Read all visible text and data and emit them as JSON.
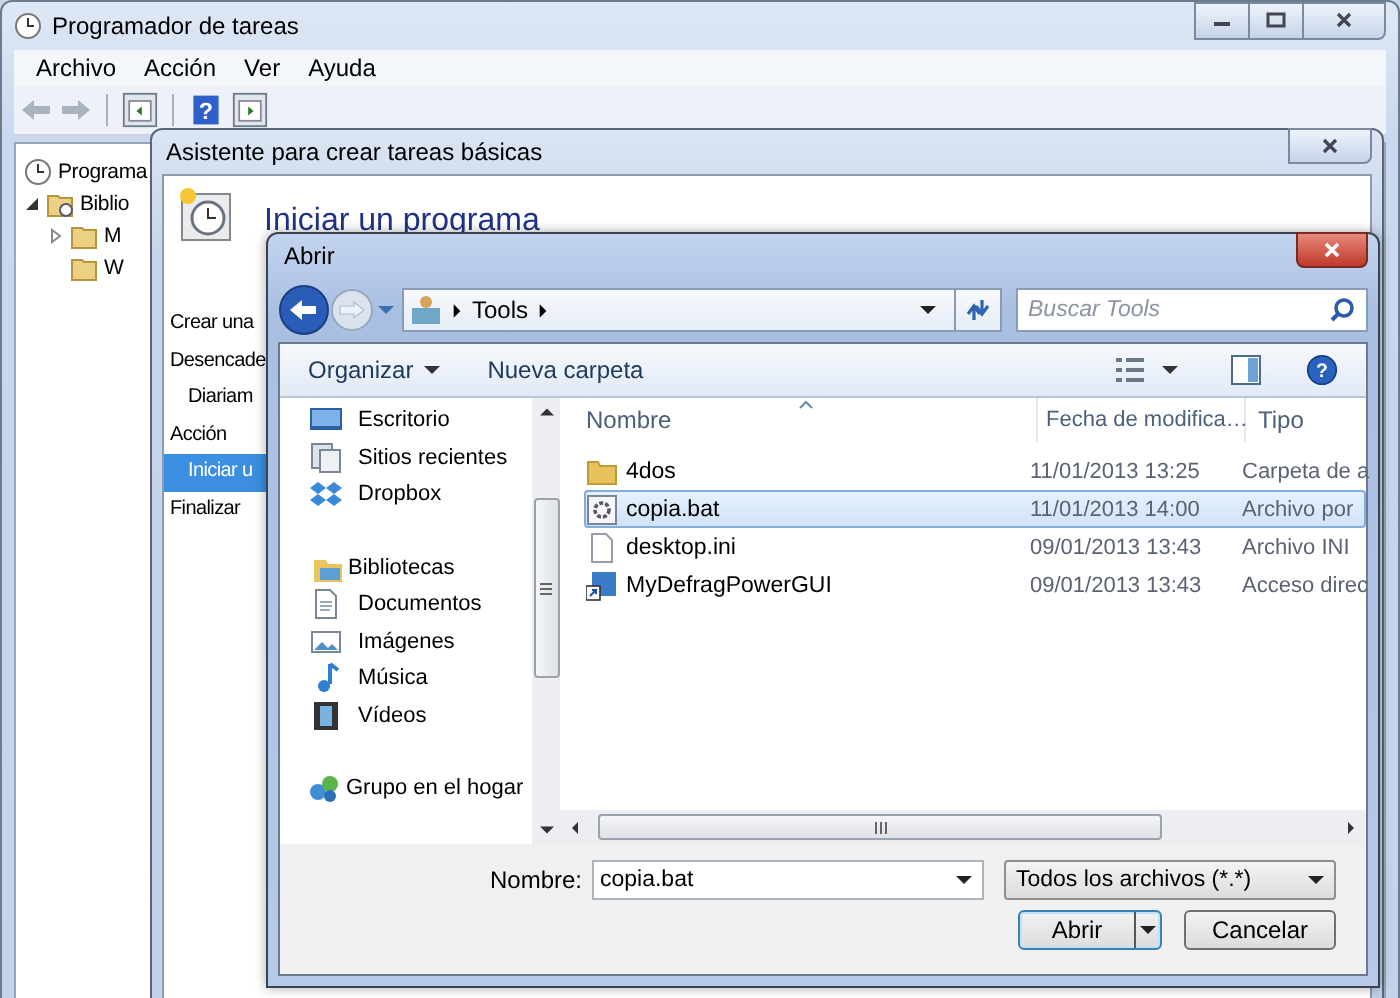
{
  "main_window": {
    "title": "Programador de tareas",
    "menu": [
      "Archivo",
      "Acción",
      "Ver",
      "Ayuda"
    ],
    "help_glyph": "?",
    "tree": [
      {
        "label": "Programa",
        "children": [
          {
            "label": "Biblio",
            "expanded": true,
            "children": [
              {
                "label": "M",
                "expanded": false
              },
              {
                "label": "W"
              }
            ]
          }
        ]
      }
    ]
  },
  "wizard": {
    "title": "Asistente para crear tareas básicas",
    "heading": "Iniciar un programa",
    "steps": [
      {
        "label": "Crear una",
        "selected": false
      },
      {
        "label": "Desencade",
        "selected": false,
        "children": [
          {
            "label": "Diariam",
            "selected": false
          }
        ]
      },
      {
        "label": "Acción",
        "selected": false,
        "children": [
          {
            "label": "Iniciar u",
            "selected": true
          }
        ]
      },
      {
        "label": "Finalizar",
        "selected": false
      }
    ]
  },
  "open_dialog": {
    "title": "Abrir",
    "address": [
      "Tools"
    ],
    "search": {
      "placeholder": "Buscar Tools"
    },
    "commands": [
      "Organizar",
      "Nueva carpeta"
    ],
    "nav_groups": [
      [
        {
          "label": "Escritorio",
          "kind": "desktop"
        },
        {
          "label": "Sitios recientes",
          "kind": "recent"
        },
        {
          "label": "Dropbox",
          "kind": "dropbox"
        }
      ],
      [
        {
          "label": "Bibliotecas",
          "kind": "library",
          "children": [
            {
              "label": "Documentos",
              "kind": "documents"
            },
            {
              "label": "Imágenes",
              "kind": "images"
            },
            {
              "label": "Música",
              "kind": "music"
            },
            {
              "label": "Vídeos",
              "kind": "videos"
            }
          ]
        }
      ],
      [
        {
          "label": "Grupo en el hogar",
          "kind": "homegroup"
        }
      ]
    ],
    "columns": [
      "Nombre",
      "Fecha de modifica…",
      "Tipo"
    ],
    "files": [
      {
        "name": "4dos",
        "date": "11/01/2013 13:25",
        "type": "Carpeta de a",
        "kind": "folder",
        "selected": false
      },
      {
        "name": "copia.bat",
        "date": "11/01/2013 14:00",
        "type": "Archivo por",
        "kind": "batch",
        "selected": true
      },
      {
        "name": "desktop.ini",
        "date": "09/01/2013 13:43",
        "type": "Archivo INI",
        "kind": "file",
        "selected": false
      },
      {
        "name": "MyDefragPowerGUI",
        "date": "09/01/2013 13:43",
        "type": "Acceso direc",
        "kind": "shortcut",
        "selected": false
      }
    ],
    "help_glyph": "?",
    "filename": {
      "label": "Nombre:",
      "value": "copia.bat"
    },
    "filter": "Todos los archivos (*.*)",
    "buttons": [
      {
        "label": "Abrir",
        "kind": "split",
        "default": true
      },
      {
        "label": "Cancelar",
        "kind": "plain",
        "default": false
      }
    ]
  }
}
